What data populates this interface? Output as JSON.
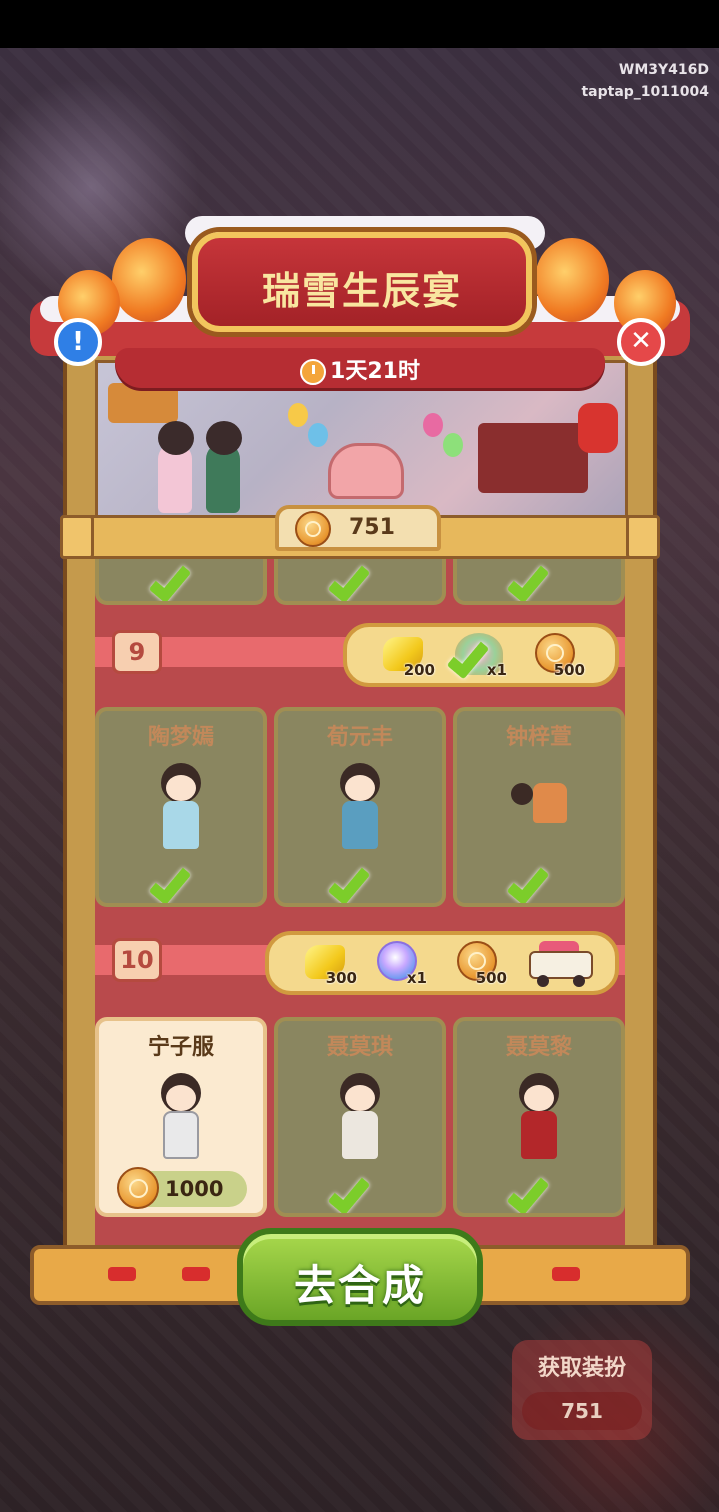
{
  "device_ids": [
    "WM3Y416D",
    "taptap_1011004"
  ],
  "event": {
    "title": "瑞雪生辰宴",
    "timer": "1天21时",
    "currency_count": "751"
  },
  "background": {
    "badge_label": "获取装扮",
    "badge_count": "751"
  },
  "tiers": [
    {
      "level": "9",
      "rewards": [
        {
          "icon": "gold-ingot-icon",
          "label": "200"
        },
        {
          "icon": "gift-basket-icon",
          "label": "x1",
          "claimed": true
        },
        {
          "icon": "token-coin-icon",
          "label": "500"
        }
      ],
      "characters": [
        {
          "name": "陶梦嫣",
          "status": "claimed"
        },
        {
          "name": "荀元丰",
          "status": "claimed"
        },
        {
          "name": "钟梓萱",
          "status": "claimed"
        }
      ]
    },
    {
      "level": "10",
      "rewards": [
        {
          "icon": "gold-ingot-icon",
          "label": "300"
        },
        {
          "icon": "crystal-icon",
          "label": "x1"
        },
        {
          "icon": "token-coin-icon",
          "label": "500"
        },
        {
          "icon": "food-truck-icon",
          "label": ""
        }
      ],
      "characters": [
        {
          "name": "宁子服",
          "status": "buy",
          "price": "1000"
        },
        {
          "name": "聂莫琪",
          "status": "claimed"
        },
        {
          "name": "聂莫黎",
          "status": "claimed"
        }
      ]
    }
  ],
  "action_button": "去合成",
  "colors": {
    "accent_red": "#b94a4c",
    "check_green": "#7ccd2a",
    "gold": "#f3c91c"
  }
}
